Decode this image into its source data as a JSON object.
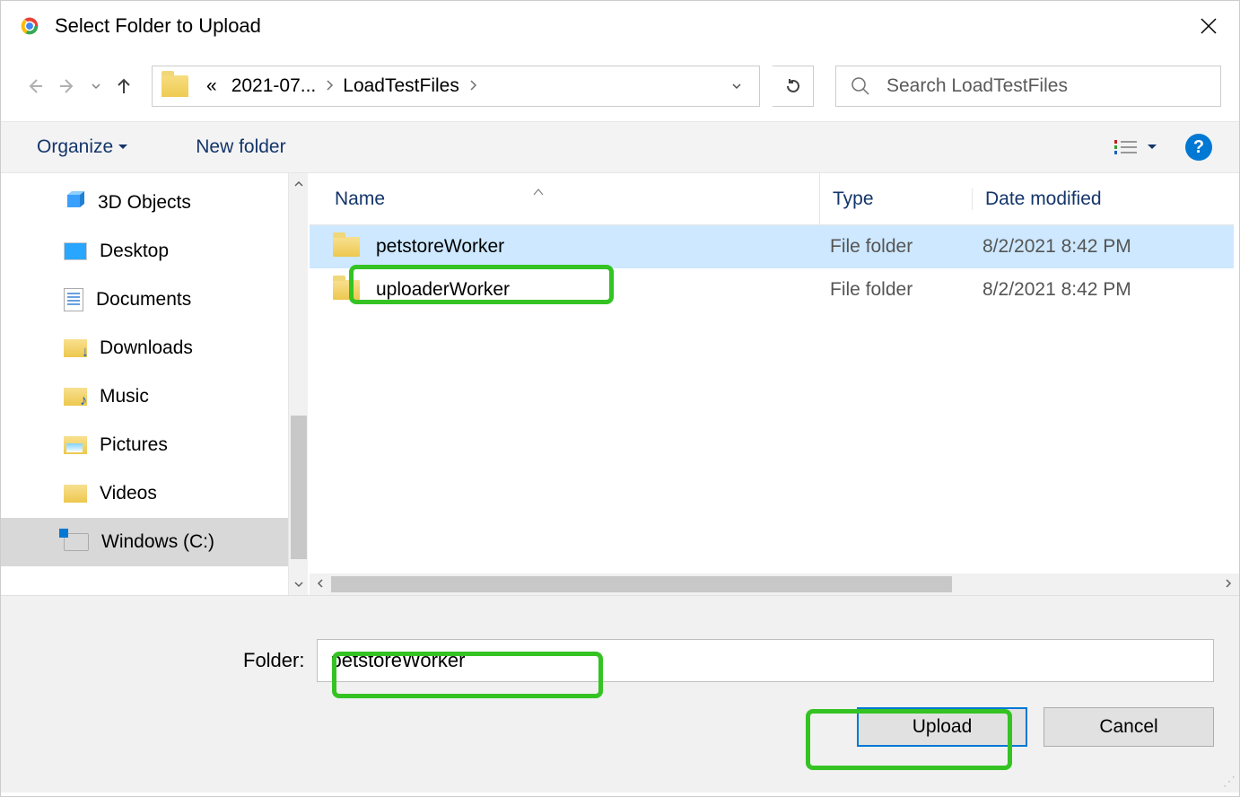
{
  "title": "Select Folder to Upload",
  "breadcrumb": {
    "prefix": "«",
    "part1": "2021-07...",
    "part2": "LoadTestFiles"
  },
  "search": {
    "placeholder": "Search LoadTestFiles"
  },
  "toolbar": {
    "organize": "Organize",
    "newfolder": "New folder"
  },
  "sidebar": [
    {
      "icon": "3d",
      "label": "3D Objects"
    },
    {
      "icon": "desktop",
      "label": "Desktop"
    },
    {
      "icon": "docs",
      "label": "Documents"
    },
    {
      "icon": "down",
      "label": "Downloads"
    },
    {
      "icon": "music",
      "label": "Music"
    },
    {
      "icon": "pics",
      "label": "Pictures"
    },
    {
      "icon": "vids",
      "label": "Videos"
    },
    {
      "icon": "drive",
      "label": "Windows (C:)",
      "selected": true
    }
  ],
  "columns": {
    "name": "Name",
    "type": "Type",
    "date": "Date modified"
  },
  "rows": [
    {
      "name": "petstoreWorker",
      "type": "File folder",
      "date": "8/2/2021 8:42 PM",
      "selected": true
    },
    {
      "name": "uploaderWorker",
      "type": "File folder",
      "date": "8/2/2021 8:42 PM",
      "selected": false
    }
  ],
  "footer": {
    "label": "Folder:",
    "value": "petstoreWorker",
    "upload": "Upload",
    "cancel": "Cancel"
  }
}
